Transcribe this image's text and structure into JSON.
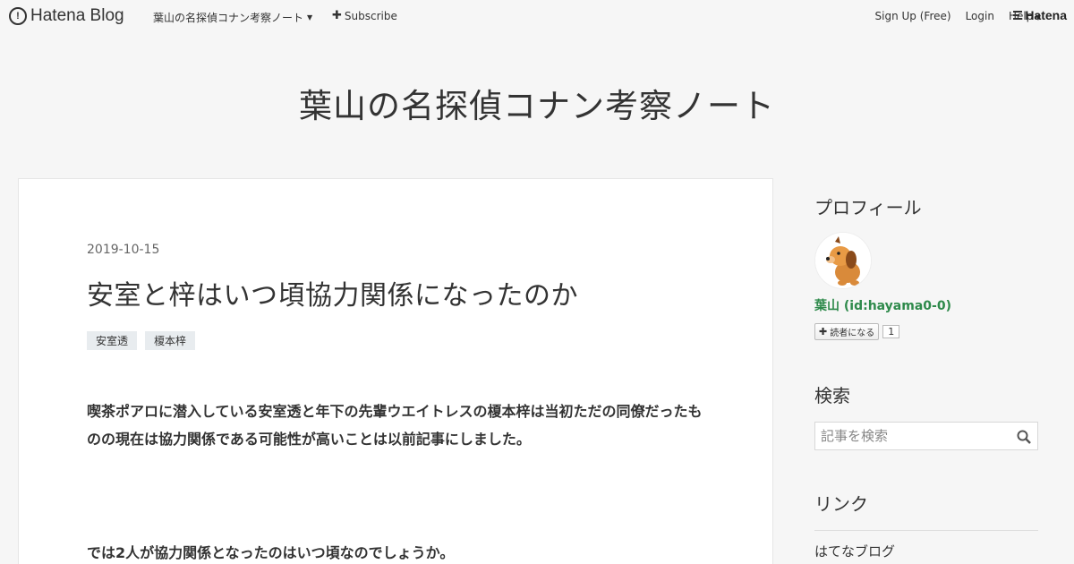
{
  "topbar": {
    "brand": "Hatena Blog",
    "blog_menu": "葉山の名探偵コナン考察ノート",
    "subscribe": "Subscribe",
    "signup": "Sign Up (Free)",
    "login": "Login",
    "help": "Help",
    "hatena": "Hatena"
  },
  "blog": {
    "title": "葉山の名探偵コナン考察ノート"
  },
  "entry": {
    "date": "2019-10-15",
    "title": "安室と梓はいつ頃協力関係になったのか",
    "tags": [
      "安室透",
      "榎本梓"
    ],
    "paragraph1": "喫茶ポアロに潜入している安室透と年下の先輩ウエイトレスの榎本梓は当初ただの同僚だったものの現在は協力関係である可能性が高いことは以前記事にしました。",
    "paragraph2": "では2人が協力関係となったのはいつ頃なのでしょうか。"
  },
  "sidebar": {
    "profile_heading": "プロフィール",
    "profile_name": "葉山 (id:hayama0-0)",
    "reader_button": "読者になる",
    "reader_count": "1",
    "search_heading": "検索",
    "search_placeholder": "記事を検索",
    "links_heading": "リンク",
    "link_item": "はてなブログ"
  },
  "colors": {
    "accent": "#2e8a4b",
    "background": "#f6f6f6"
  }
}
